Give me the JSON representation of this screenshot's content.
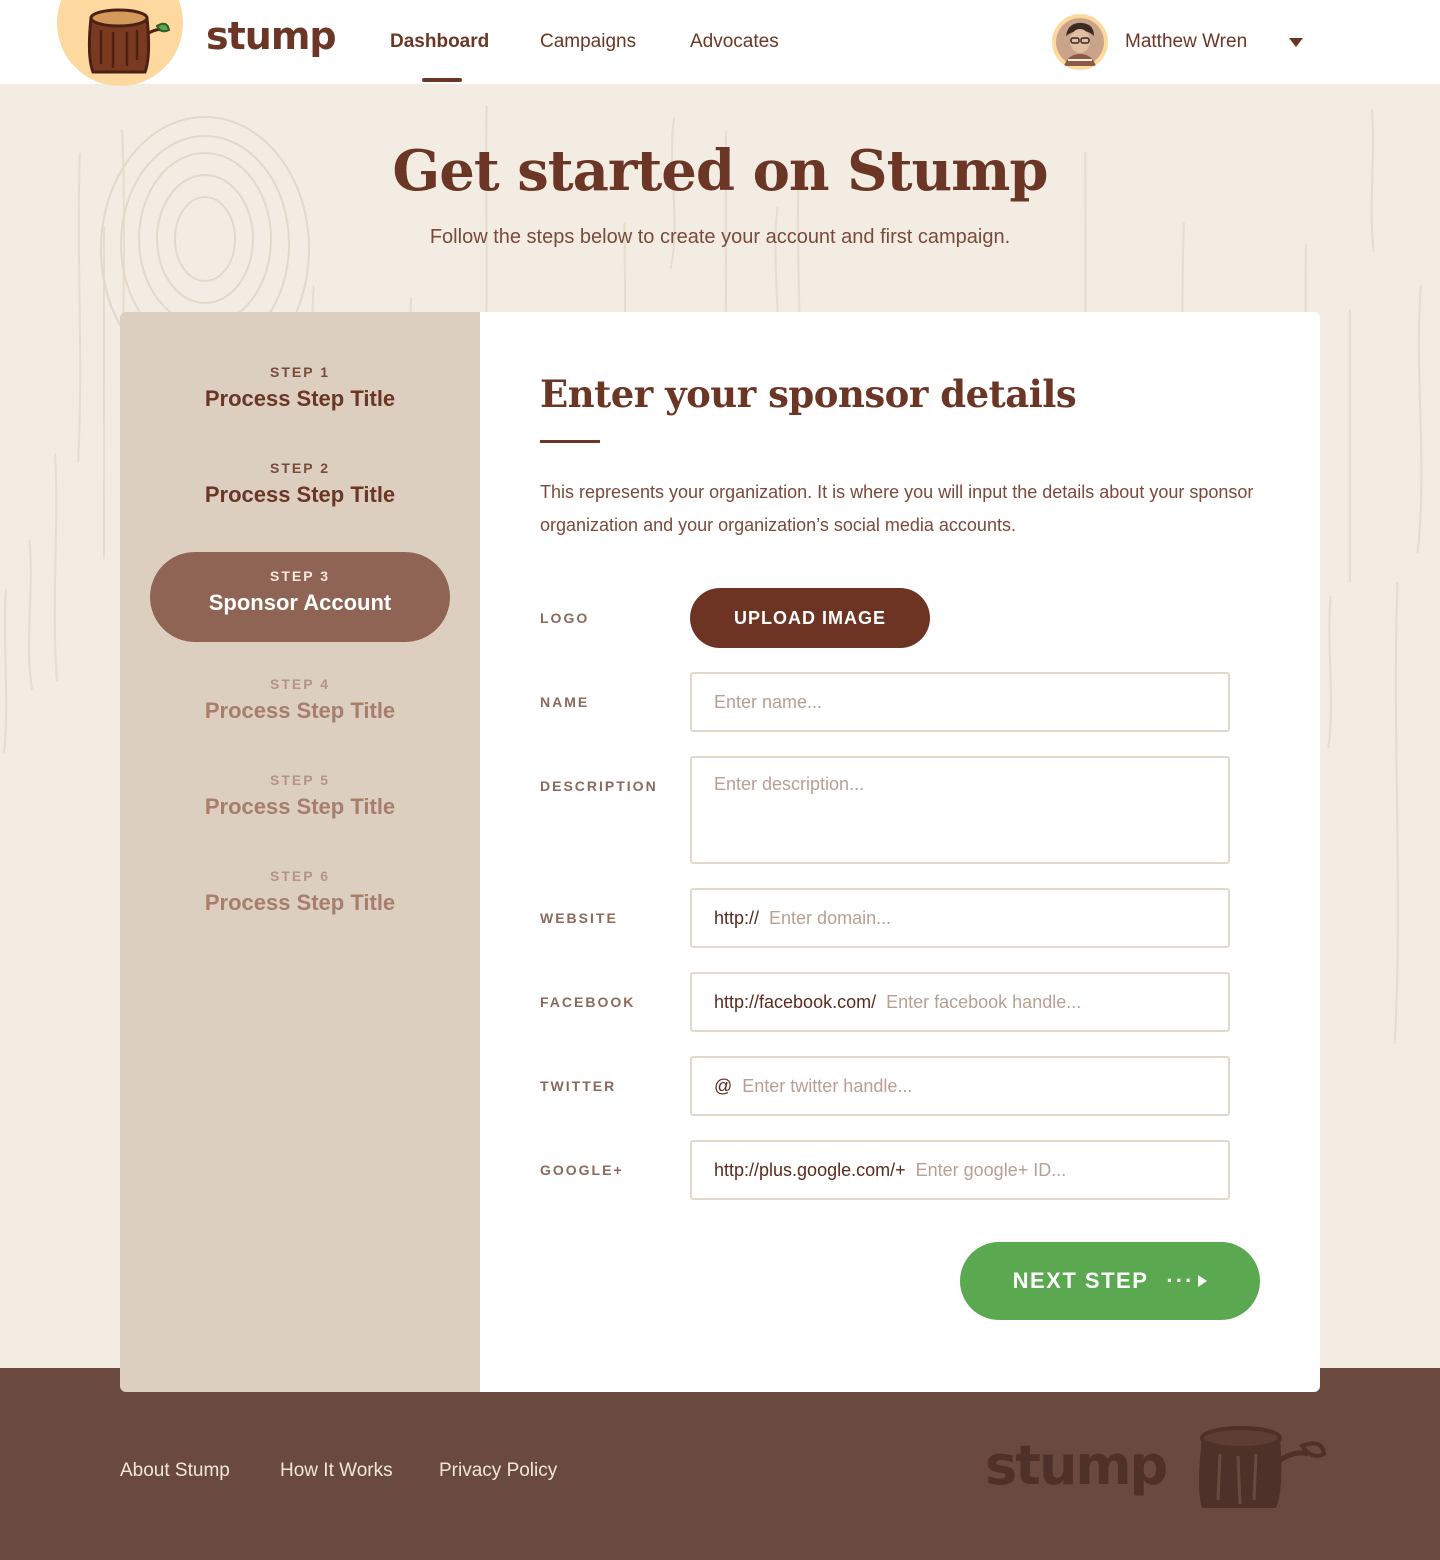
{
  "header": {
    "brand": "stump",
    "nav": [
      {
        "label": "Dashboard",
        "active": true
      },
      {
        "label": "Campaigns",
        "active": false
      },
      {
        "label": "Advocates",
        "active": false
      }
    ],
    "user": {
      "name": "Matthew Wren"
    }
  },
  "hero": {
    "title": "Get started on Stump",
    "subtitle": "Follow the steps below to create your account and first campaign."
  },
  "steps": [
    {
      "label": "STEP 1",
      "title": "Process Step Title",
      "state": "done"
    },
    {
      "label": "STEP 2",
      "title": "Process Step Title",
      "state": "done"
    },
    {
      "label": "STEP 3",
      "title": "Sponsor Account",
      "state": "active"
    },
    {
      "label": "STEP 4",
      "title": "Process Step Title",
      "state": "upcoming"
    },
    {
      "label": "STEP 5",
      "title": "Process Step Title",
      "state": "upcoming"
    },
    {
      "label": "STEP 6",
      "title": "Process Step Title",
      "state": "upcoming"
    }
  ],
  "panel": {
    "title": "Enter your sponsor details",
    "description": "This represents your organization. It is where you will input the details about your sponsor organization and your organization’s social media accounts.",
    "upload_label": "UPLOAD IMAGE",
    "next_label": "NEXT STEP",
    "next_dots": "···",
    "fields": {
      "logo": {
        "label": "LOGO"
      },
      "name": {
        "label": "NAME",
        "placeholder": "Enter name..."
      },
      "description": {
        "label": "DESCRIPTION",
        "placeholder": "Enter description..."
      },
      "website": {
        "label": "WEBSITE",
        "prefix": "http://",
        "placeholder": "Enter domain..."
      },
      "facebook": {
        "label": "FACEBOOK",
        "prefix": "http://facebook.com/",
        "placeholder": "Enter facebook handle..."
      },
      "twitter": {
        "label": "TWITTER",
        "prefix": "@",
        "placeholder": "Enter twitter handle..."
      },
      "google": {
        "label": "GOOGLE+",
        "prefix": "http://plus.google.com/+",
        "placeholder": "Enter google+ ID..."
      }
    }
  },
  "footer": {
    "links": [
      "About Stump",
      "How It Works",
      "Privacy Policy"
    ],
    "brand": "stump"
  },
  "colors": {
    "brand_brown": "#6b3626",
    "accent_green": "#5aa850",
    "logo_bg": "#fdd9a0",
    "sidebar_bg": "#dccfbf",
    "active_step_bg": "#8f6454",
    "footer_bg": "#6a4a3e"
  },
  "icons": {
    "logo": "tree-stump-icon",
    "caret": "caret-down-icon",
    "next": "arrow-right-icon"
  }
}
